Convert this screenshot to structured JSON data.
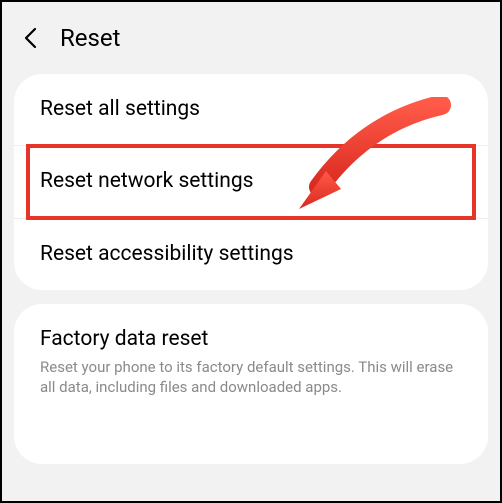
{
  "header": {
    "title": "Reset"
  },
  "card1": {
    "items": [
      {
        "title": "Reset all settings"
      },
      {
        "title": "Reset network settings"
      },
      {
        "title": "Reset accessibility settings"
      }
    ]
  },
  "card2": {
    "title": "Factory data reset",
    "subtitle": "Reset your phone to its factory default settings. This will erase all data, including files and downloaded apps."
  },
  "annotation": {
    "highlight_color": "#e63528",
    "arrow_color": "#e63528"
  }
}
